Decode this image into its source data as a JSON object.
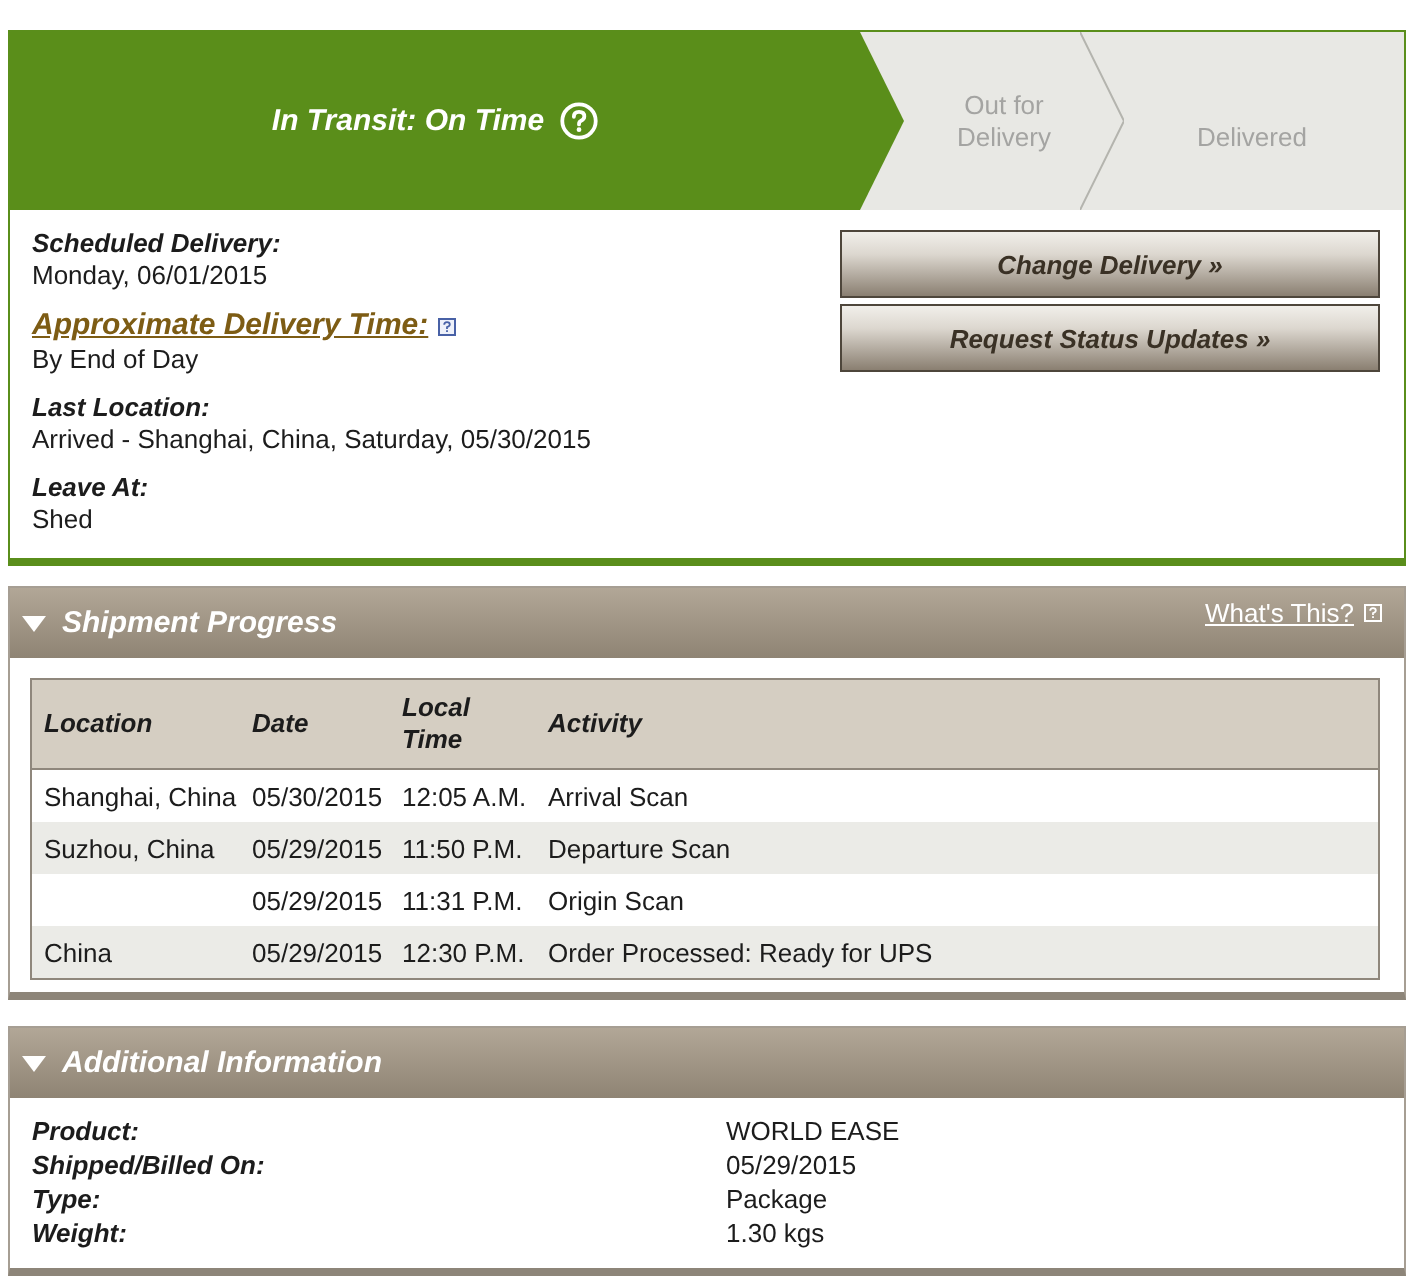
{
  "progress_steps": [
    {
      "label": "In Transit: On Time",
      "current": true,
      "help": true
    },
    {
      "label": "Out for Delivery",
      "current": false,
      "help": false
    },
    {
      "label": "Delivered",
      "current": false,
      "help": false
    }
  ],
  "delivery_details": [
    {
      "kind": "text",
      "label": "Scheduled Delivery:",
      "value": "Monday, 06/01/2015"
    },
    {
      "kind": "link",
      "label": "Approximate Delivery Time:",
      "value": "By End of Day"
    },
    {
      "kind": "text",
      "label": "Last Location:",
      "value": "Arrived - Shanghai, China, Saturday, 05/30/2015"
    },
    {
      "kind": "text",
      "label": "Leave At:",
      "value": "Shed"
    }
  ],
  "actions": [
    "Change Delivery »",
    "Request Status Updates »"
  ],
  "shipment_progress": {
    "title": "Shipment Progress",
    "expanded": true,
    "help_link": "What's This?",
    "table": {
      "columns": [
        "Location",
        "Date",
        "Local Time",
        "Activity"
      ],
      "rows": [
        {
          "location": "Shanghai, China",
          "date": "05/30/2015",
          "local_time": "12:05 A.M.",
          "activity": "Arrival Scan"
        },
        {
          "location": "Suzhou, China",
          "date": "05/29/2015",
          "local_time": "11:50 P.M.",
          "activity": "Departure Scan"
        },
        {
          "date": "05/29/2015",
          "local_time": "11:31 P.M.",
          "activity": "Origin Scan"
        },
        {
          "location": "China",
          "date": "05/29/2015",
          "local_time": "12:30 P.M.",
          "activity": "Order Processed: Ready for UPS"
        }
      ]
    }
  },
  "additional_information": {
    "title": "Additional Information",
    "expanded": true,
    "fields": [
      {
        "label": "Product:",
        "value": "WORLD EASE"
      },
      {
        "label": "Shipped/Billed On:",
        "value": "05/29/2015"
      },
      {
        "label": "Type:",
        "value": "Package"
      },
      {
        "label": "Weight:",
        "value": "1.30 kgs"
      }
    ]
  }
}
